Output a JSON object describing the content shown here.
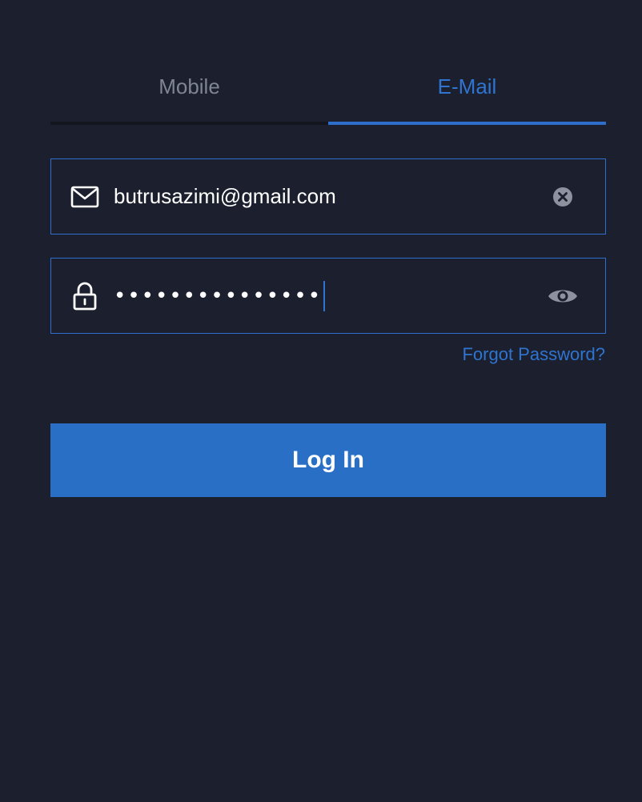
{
  "tabs": {
    "mobile": "Mobile",
    "email": "E-Mail"
  },
  "email_field": {
    "value": "butrusazimi@gmail.com",
    "lead_icon": "mail-icon",
    "trail_icon": "clear-circle-x-icon"
  },
  "password_field": {
    "masked_value": "•••••••••••••••",
    "lead_icon": "lock-icon",
    "trail_icon": "eye-icon"
  },
  "forgot_password": "Forgot Password?",
  "login_button": "Log In",
  "colors": {
    "background": "#1c202e",
    "accent": "#2e74d0",
    "button": "#2a6fc6",
    "muted": "#7f8593"
  }
}
